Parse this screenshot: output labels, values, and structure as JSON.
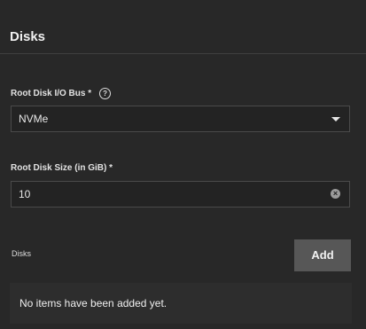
{
  "section": {
    "title": "Disks"
  },
  "root_disk_bus": {
    "label": "Root Disk I/O Bus *",
    "help_icon": "question-circle-icon",
    "value": "NVMe"
  },
  "root_disk_size": {
    "label": "Root Disk Size (in GiB) *",
    "value": "10",
    "clear_icon": "clear-icon"
  },
  "disks": {
    "label": "Disks",
    "add_label": "Add",
    "empty_message": "No items have been added yet."
  }
}
